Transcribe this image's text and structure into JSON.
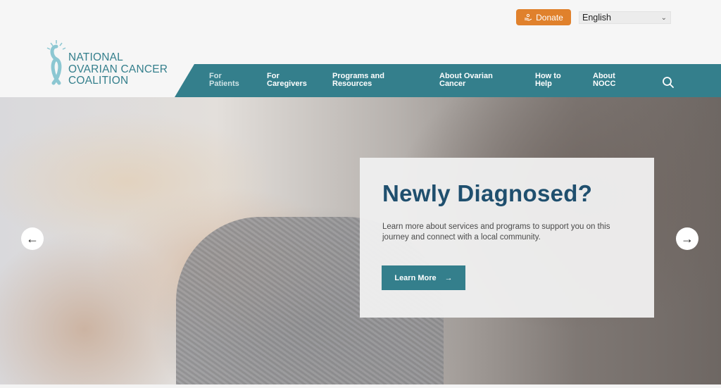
{
  "header": {
    "donate_label": "Donate",
    "language_selected": "English",
    "logo": {
      "line1": "NATIONAL",
      "line2": "OVARIAN CANCER",
      "line3": "COALITION"
    },
    "colors": {
      "teal": "#347f8c",
      "orange": "#e0812c",
      "navy": "#1f4f6e"
    }
  },
  "nav": {
    "items": [
      {
        "line1": "For",
        "line2": "Patients"
      },
      {
        "line1": "For",
        "line2": "Caregivers"
      },
      {
        "line1": "Programs and",
        "line2": "Resources"
      },
      {
        "line1": "About Ovarian",
        "line2": "Cancer"
      },
      {
        "line1": "How to",
        "line2": "Help"
      },
      {
        "line1": "About",
        "line2": "NOCC"
      }
    ],
    "search_icon": "search-icon"
  },
  "hero": {
    "title": "Newly Diagnosed?",
    "body": "Learn more about services and programs to support you on this journey and connect with a local community.",
    "cta_label": "Learn More",
    "prev_arrow": "←",
    "next_arrow": "→"
  }
}
